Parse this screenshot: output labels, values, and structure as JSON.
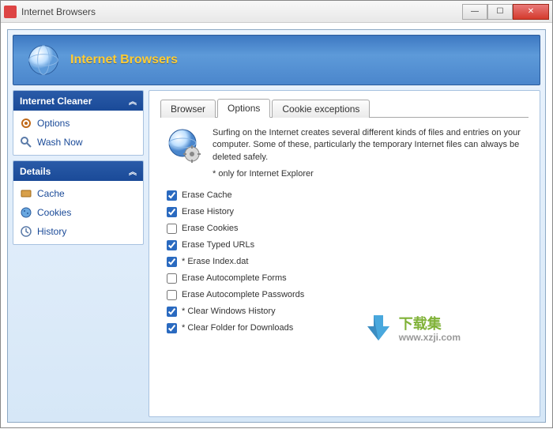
{
  "window": {
    "title": "Internet Browsers"
  },
  "banner": {
    "title": "Internet Browsers"
  },
  "sidebar": {
    "panels": [
      {
        "title": "Internet Cleaner",
        "items": [
          {
            "label": "Options",
            "icon": "gear-icon"
          },
          {
            "label": "Wash Now",
            "icon": "magnifier-icon"
          }
        ]
      },
      {
        "title": "Details",
        "items": [
          {
            "label": "Cache",
            "icon": "cache-icon"
          },
          {
            "label": "Cookies",
            "icon": "cookie-icon"
          },
          {
            "label": "History",
            "icon": "history-icon"
          }
        ]
      }
    ]
  },
  "tabs": [
    {
      "label": "Browser"
    },
    {
      "label": "Options"
    },
    {
      "label": "Cookie exceptions"
    }
  ],
  "active_tab": 1,
  "info": {
    "text": "Surfing on the Internet creates several different kinds of files and entries on your computer. Some of these, particularly the temporary Internet files can always be deleted safely.",
    "note": "*  only for Internet Explorer"
  },
  "options": [
    {
      "label": "Erase Cache",
      "checked": true
    },
    {
      "label": "Erase History",
      "checked": true
    },
    {
      "label": "Erase Cookies",
      "checked": false
    },
    {
      "label": "Erase Typed URLs",
      "checked": true
    },
    {
      "label": "* Erase Index.dat",
      "checked": true
    },
    {
      "label": "Erase Autocomplete Forms",
      "checked": false
    },
    {
      "label": "Erase Autocomplete Passwords",
      "checked": false
    },
    {
      "label": "* Clear Windows History",
      "checked": true
    },
    {
      "label": "* Clear Folder for Downloads",
      "checked": true
    }
  ],
  "watermark": {
    "cn": "下载集",
    "url": "www.xzji.com"
  }
}
